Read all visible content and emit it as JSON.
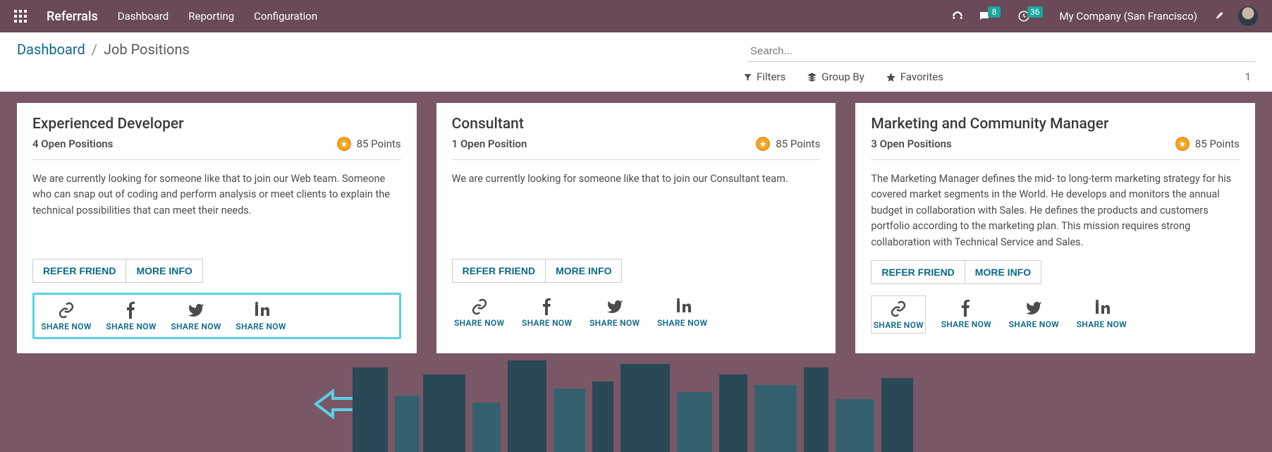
{
  "topbar": {
    "app_name": "Referrals",
    "nav": [
      "Dashboard",
      "Reporting",
      "Configuration"
    ],
    "chat_badge": "8",
    "clock_badge": "36",
    "company": "My Company (San Francisco)"
  },
  "breadcrumb": {
    "parent": "Dashboard",
    "current": "Job Positions"
  },
  "search": {
    "placeholder": "Search..."
  },
  "filters": {
    "filters_label": "Filters",
    "groupby_label": "Group By",
    "favorites_label": "Favorites",
    "page": "1"
  },
  "cards": [
    {
      "title": "Experienced Developer",
      "open_positions": "4 Open Positions",
      "points": "85 Points",
      "description": "We are currently looking for someone like that to join our Web team. Someone who can snap out of coding and perform analysis or meet clients to explain the technical possibilities that can meet their needs.",
      "refer_label": "REFER FRIEND",
      "more_label": "MORE INFO",
      "share_label": "SHARE NOW",
      "highlighted": true
    },
    {
      "title": "Consultant",
      "open_positions": "1 Open Position",
      "points": "85 Points",
      "description": "We are currently looking for someone like that to join our Consultant team.",
      "refer_label": "REFER FRIEND",
      "more_label": "MORE INFO",
      "share_label": "SHARE NOW",
      "highlighted": false
    },
    {
      "title": "Marketing and Community Manager",
      "open_positions": "3 Open Positions",
      "points": "85 Points",
      "description": "The Marketing Manager defines the mid- to long-term marketing strategy for his covered market segments in the World. He develops and monitors the annual budget in collaboration with Sales. He defines the products and customers portfolio according to the marketing plan. This mission requires strong collaboration with Technical Service and Sales.",
      "refer_label": "REFER FRIEND",
      "more_label": "MORE INFO",
      "share_label": "SHARE NOW",
      "highlighted": false,
      "link_selected": true
    }
  ]
}
